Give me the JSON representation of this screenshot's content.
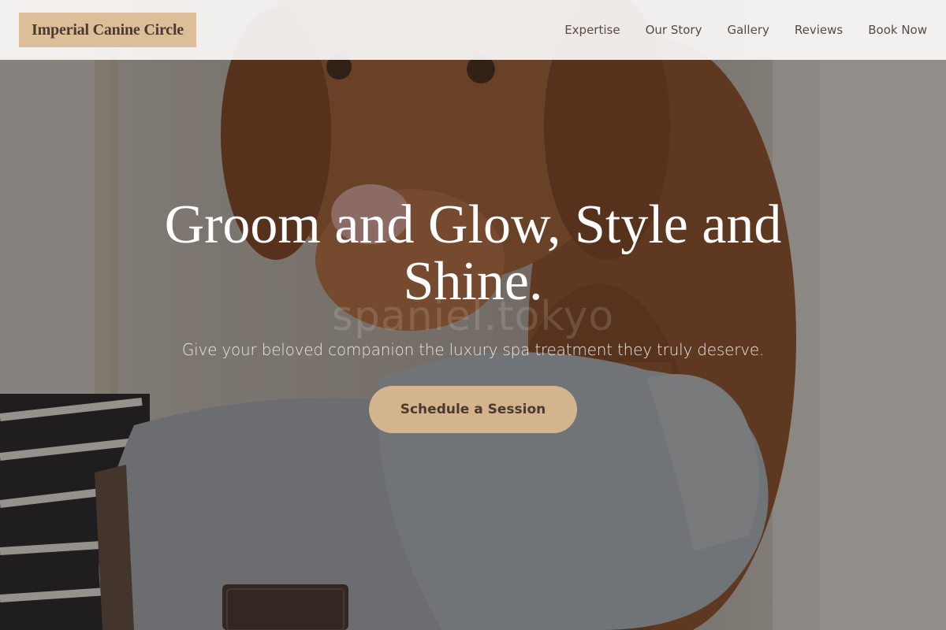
{
  "brand": {
    "name": "Imperial Canine Circle"
  },
  "nav": {
    "items": [
      {
        "label": "Expertise"
      },
      {
        "label": "Our Story"
      },
      {
        "label": "Gallery"
      },
      {
        "label": "Reviews"
      },
      {
        "label": "Book Now"
      }
    ]
  },
  "hero": {
    "headline": "Groom and Glow, Style and Shine.",
    "subtext": "Give your beloved companion the luxury spa treatment they truly deserve.",
    "cta_label": "Schedule a Session",
    "watermark": "spaniel.tokyo"
  },
  "colors": {
    "accent": "#dcbf99",
    "cta": "#d4b48c",
    "text_dark": "#4a3a30",
    "nav_text": "#5a4a40"
  }
}
